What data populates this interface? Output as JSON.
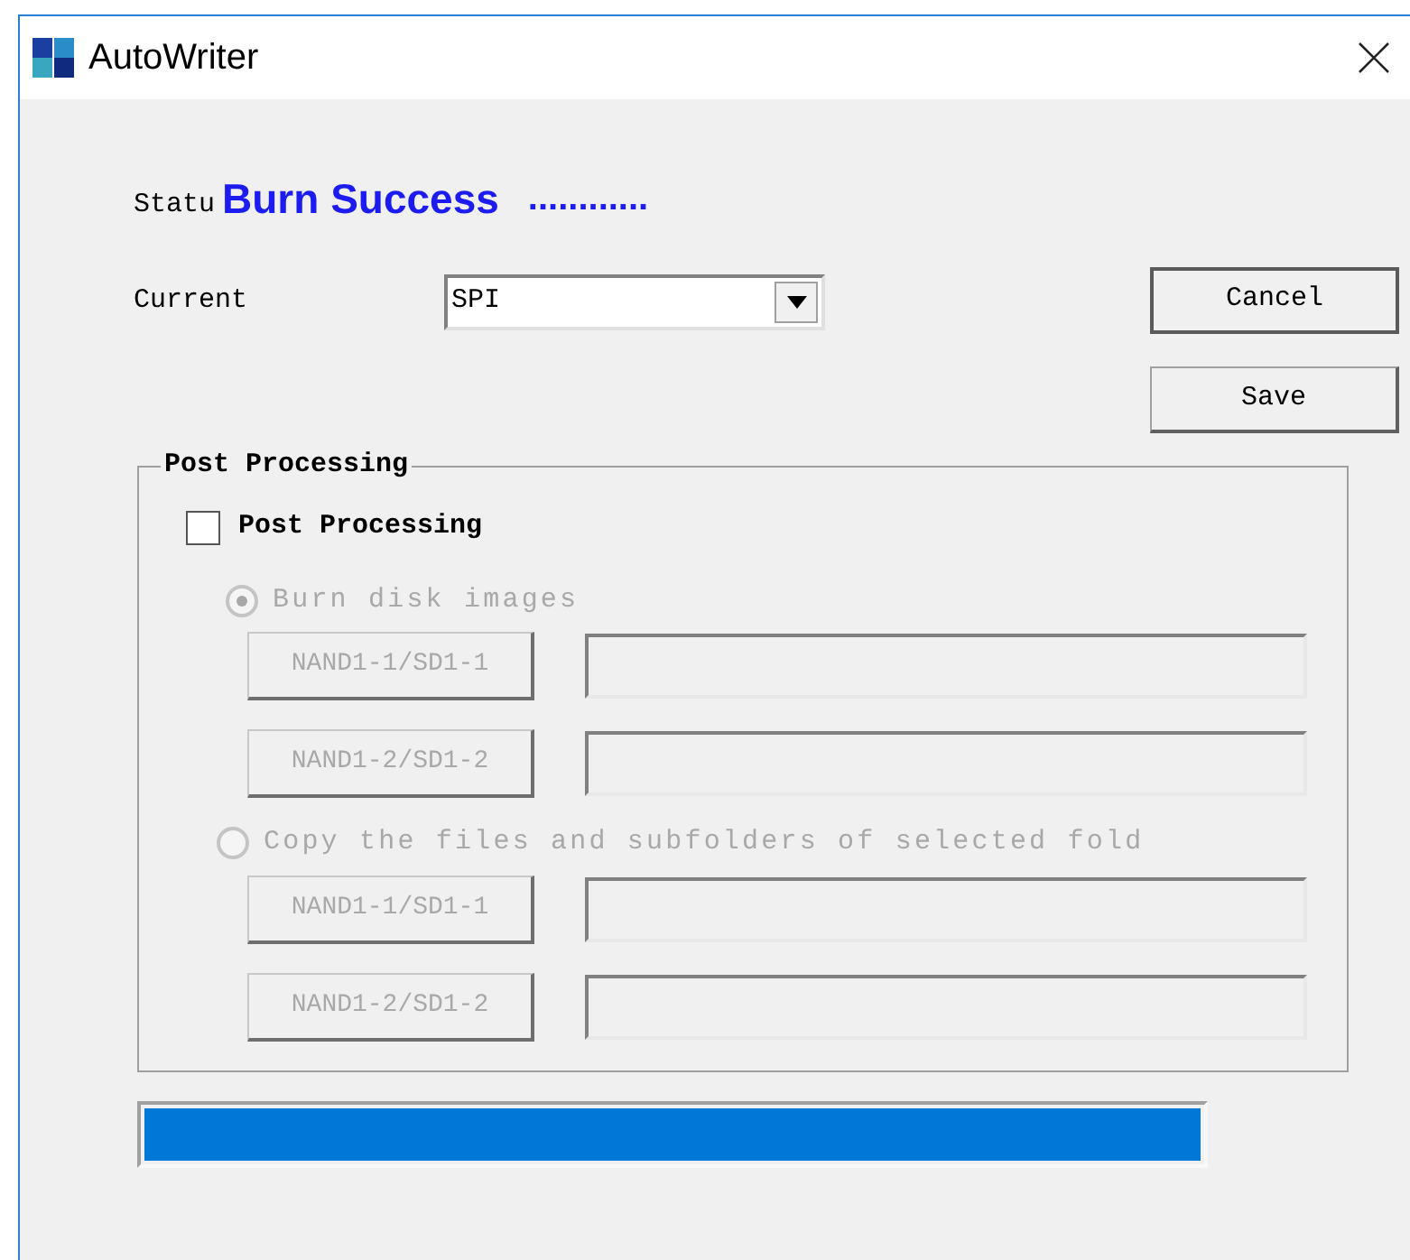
{
  "window": {
    "title": "AutoWriter"
  },
  "status": {
    "label": "Statu",
    "value": "Burn Success",
    "dots": "............"
  },
  "current": {
    "label": "Current",
    "value": "SPI"
  },
  "buttons": [
    {
      "label": "Cancel",
      "default": true
    },
    {
      "label": "Save",
      "default": false
    }
  ],
  "post_processing": {
    "title": "Post Processing",
    "checkbox": {
      "label": "Post Processing",
      "checked": false
    },
    "options": [
      {
        "label": "Burn disk images",
        "selected": true,
        "disabled": true,
        "slots": [
          {
            "button": "NAND1-1/SD1-1"
          },
          {
            "button": "NAND1-2/SD1-2"
          }
        ]
      },
      {
        "label": "Copy the files and subfolders of selected fold",
        "selected": false,
        "disabled": true,
        "slots": [
          {
            "button": "NAND1-1/SD1-1"
          },
          {
            "button": "NAND1-2/SD1-2"
          }
        ]
      }
    ]
  },
  "progress": {
    "level": 1
  }
}
